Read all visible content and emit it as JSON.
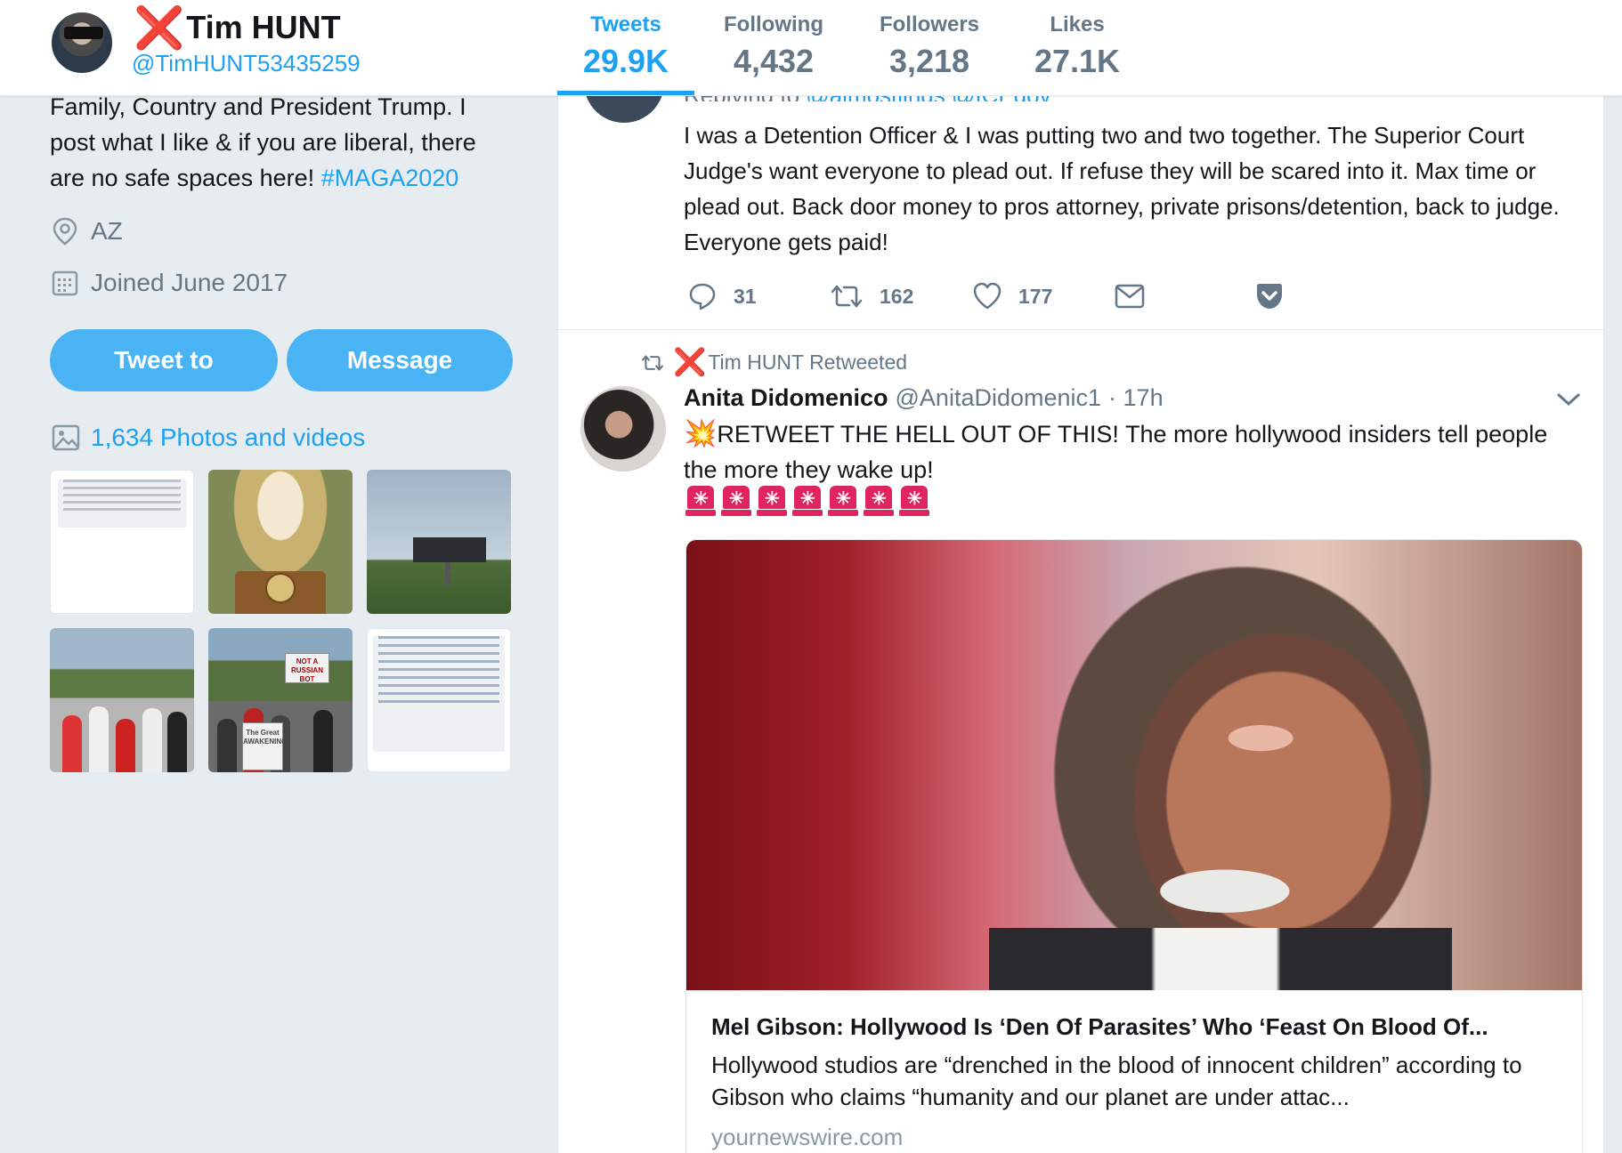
{
  "header": {
    "name": "Tim HUNT",
    "name_prefix": "❌",
    "handle": "@TimHUNT53435259",
    "stats": [
      {
        "label": "Tweets",
        "value": "29.9K",
        "active": true
      },
      {
        "label": "Following",
        "value": "4,432"
      },
      {
        "label": "Followers",
        "value": "3,218"
      },
      {
        "label": "Likes",
        "value": "27.1K"
      }
    ]
  },
  "sidebar": {
    "bio_text": "Family, Country and President Trump. I post what I like & if you are liberal, there are no safe spaces here!",
    "bio_hashtag": "#MAGA2020",
    "location": "AZ",
    "joined": "Joined June 2017",
    "tweet_to_label": "Tweet to",
    "message_label": "Message",
    "photos_label": "1,634 Photos and videos",
    "thumb_sign_text": "NOT A RUSSIAN BOT",
    "thumb_awakening_text": "The Great AWAKENING"
  },
  "tweet1": {
    "replying_prefix": "Replying to",
    "replying_handles": "@almostjings @ICEgov",
    "text": "I was a Detention Officer & I was putting two and two together. The Superior Court Judge's want everyone to plead out. If refuse they will be scared into it. Max time or plead out. Back door money to pros attorney, private prisons/detention, back to judge. Everyone gets paid!",
    "replies": "31",
    "retweets": "162",
    "likes": "177"
  },
  "tweet2": {
    "retweeted_by": "Tim HUNT Retweeted",
    "author_name": "Anita Didomenico",
    "author_handle": "@AnitaDidomenic1",
    "time": "· 17h",
    "emoji_prefix": "💥",
    "text": "RETWEET THE HELL OUT OF THIS! The more hollywood insiders tell people the more they wake up!",
    "siren_count": 7,
    "card": {
      "title": "Mel Gibson: Hollywood Is ‘Den Of Parasites’ Who ‘Feast On Blood Of...",
      "description": "Hollywood studios are “drenched in the blood of innocent children” according to Gibson who claims “humanity and our planet are under attac...",
      "domain": "yournewswire.com"
    }
  },
  "colors": {
    "accent": "#1da1f2",
    "button": "#4ab3f4",
    "muted": "#657786",
    "x_mark": "#e0245e",
    "background": "#e6ecf0"
  },
  "icons": [
    "location-pin-icon",
    "calendar-icon",
    "photo-icon",
    "reply-icon",
    "retweet-icon",
    "heart-icon",
    "mail-icon",
    "pocket-icon",
    "chevron-down-icon",
    "police-siren-icon",
    "collision-icon"
  ]
}
